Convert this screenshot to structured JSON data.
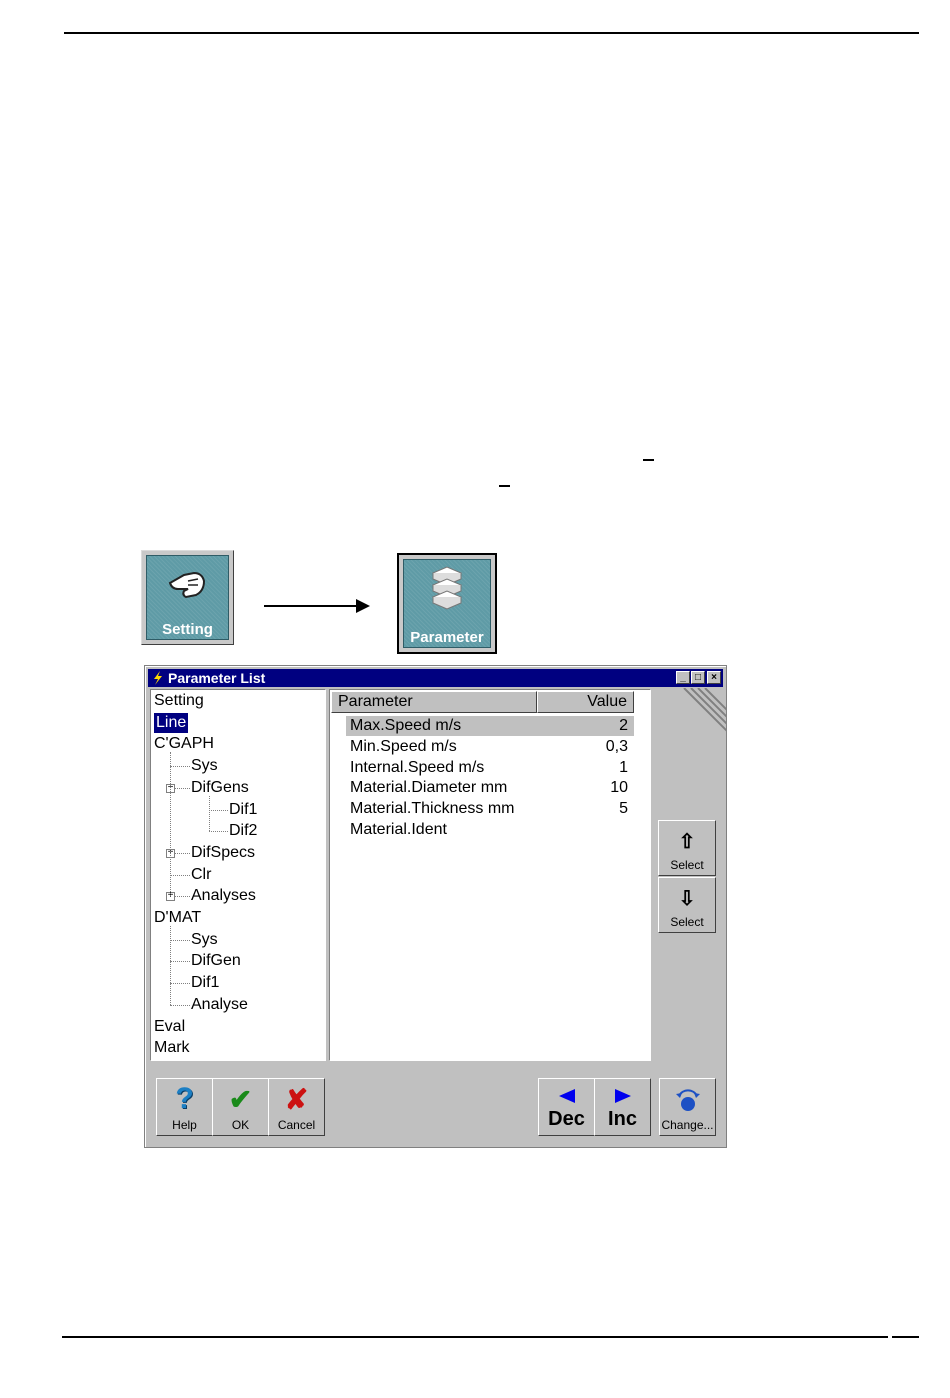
{
  "setting_button": {
    "label": "Setting"
  },
  "parameter_button": {
    "label": "Parameter"
  },
  "window": {
    "title": "Parameter List",
    "controls": {
      "minimize": "_",
      "maximize": "□",
      "close": "×"
    }
  },
  "tree": {
    "items": [
      {
        "label": "Setting",
        "level": 0
      },
      {
        "label": "Line",
        "level": 0,
        "selected": true
      },
      {
        "label": "C'GAPH",
        "level": 0
      },
      {
        "label": "Sys",
        "level": 1
      },
      {
        "label": "DifGens",
        "level": 1,
        "expand": "−"
      },
      {
        "label": "Dif1",
        "level": 2
      },
      {
        "label": "Dif2",
        "level": 2
      },
      {
        "label": "DifSpecs",
        "level": 1,
        "expand": "+"
      },
      {
        "label": "Clr",
        "level": 1
      },
      {
        "label": "Analyses",
        "level": 1,
        "expand": "+"
      },
      {
        "label": "D'MAT",
        "level": 0
      },
      {
        "label": "Sys",
        "level": 1
      },
      {
        "label": "DifGen",
        "level": 1
      },
      {
        "label": "Dif1",
        "level": 1
      },
      {
        "label": "Analyse",
        "level": 1
      },
      {
        "label": "Eval",
        "level": 0
      },
      {
        "label": "Mark",
        "level": 0
      }
    ]
  },
  "table": {
    "col_parameter": "Parameter",
    "col_value": "Value",
    "rows": [
      {
        "name": "Max.Speed m/s",
        "value": "2",
        "highlighted": true
      },
      {
        "name": "Min.Speed m/s",
        "value": "0,3"
      },
      {
        "name": "Internal.Speed m/s",
        "value": "1"
      },
      {
        "name": "Material.Diameter mm",
        "value": "10"
      },
      {
        "name": "Material.Thickness mm",
        "value": "5"
      },
      {
        "name": "Material.Ident",
        "value": ""
      }
    ]
  },
  "side_buttons": {
    "select_up": {
      "symbol": "⇧",
      "label": "Select"
    },
    "select_down": {
      "symbol": "⇩",
      "label": "Select"
    }
  },
  "bottom_buttons": {
    "help": {
      "symbol": "?",
      "label": "Help"
    },
    "ok": {
      "symbol": "✔",
      "label": "OK"
    },
    "cancel": {
      "symbol": "✘",
      "label": "Cancel"
    },
    "dec": {
      "label": "Dec"
    },
    "inc": {
      "label": "Inc"
    },
    "change": {
      "label": "Change..."
    }
  },
  "colors": {
    "title_bg": "#000080",
    "face": "#c0c0c0",
    "icon_teal": "#5f9ba6",
    "help_blue": "#1c7fc4",
    "ok_green": "#1a8a1a",
    "cancel_red": "#cc1111"
  }
}
